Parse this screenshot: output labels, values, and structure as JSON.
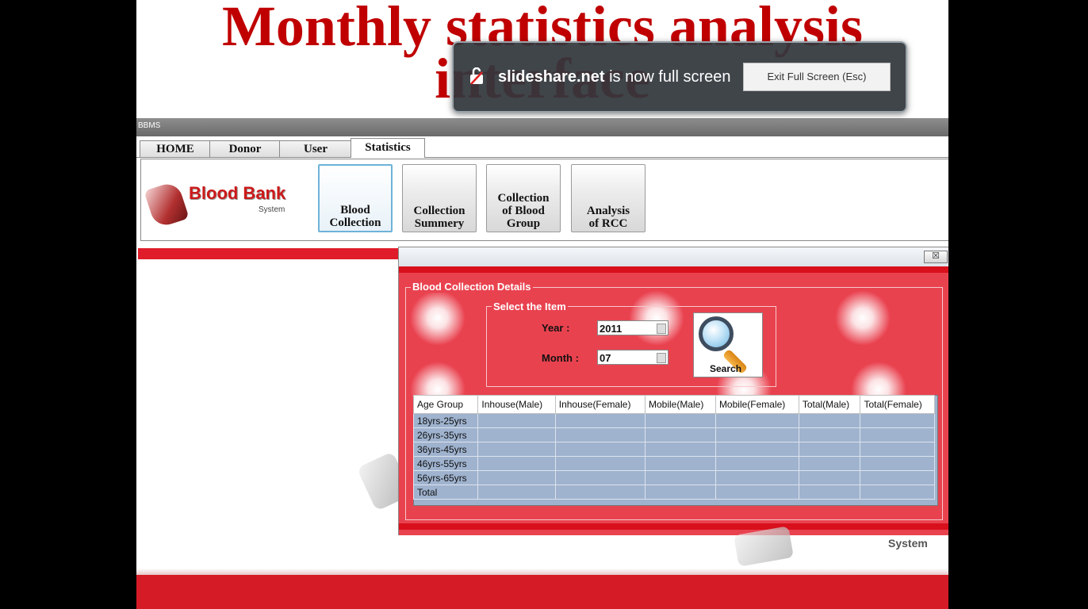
{
  "slide": {
    "title_line1": "Monthly statistics analysis",
    "title_line2": "interface"
  },
  "fullscreen_notice": {
    "site": "slideshare.net",
    "message": " is now full screen",
    "exit_label": "Exit Full Screen (Esc)"
  },
  "app": {
    "window_title": "BBMS",
    "tabs": [
      {
        "label": "HOME"
      },
      {
        "label": "Donor"
      },
      {
        "label": "User"
      },
      {
        "label": "Statistics",
        "active": true
      }
    ],
    "logo": {
      "name": "Blood Bank",
      "sub": "System"
    },
    "ribbon_buttons": [
      {
        "line1": "Blood",
        "line2": "Collection",
        "active": true
      },
      {
        "line1": "Collection",
        "line2": "Summery"
      },
      {
        "line1": "Collection",
        "line2": "of Blood",
        "line3": "Group"
      },
      {
        "line1": "Analysis",
        "line2": "of RCC"
      }
    ]
  },
  "dialog": {
    "close_symbol": "☒",
    "group_title": "Blood Collection Details",
    "select_title": "Select the Item",
    "year_label": "Year :",
    "year_value": "2011",
    "month_label": "Month :",
    "month_value": "07",
    "search_label": "Search",
    "table": {
      "columns": [
        "Age Group",
        "Inhouse(Male)",
        "Inhouse(Female)",
        "Mobile(Male)",
        "Mobile(Female)",
        "Total(Male)",
        "Total(Female)"
      ],
      "rows": [
        "18yrs-25yrs",
        "26yrs-35yrs",
        "36yrs-45yrs",
        "46yrs-55yrs",
        "56yrs-65yrs",
        "Total"
      ]
    }
  },
  "footer": {
    "system_text": "System"
  },
  "colors": {
    "title_red": "#c00000",
    "dialog_red": "#e9424f",
    "bar_red": "#d51b26",
    "grid_blue": "#9fb3cf"
  }
}
